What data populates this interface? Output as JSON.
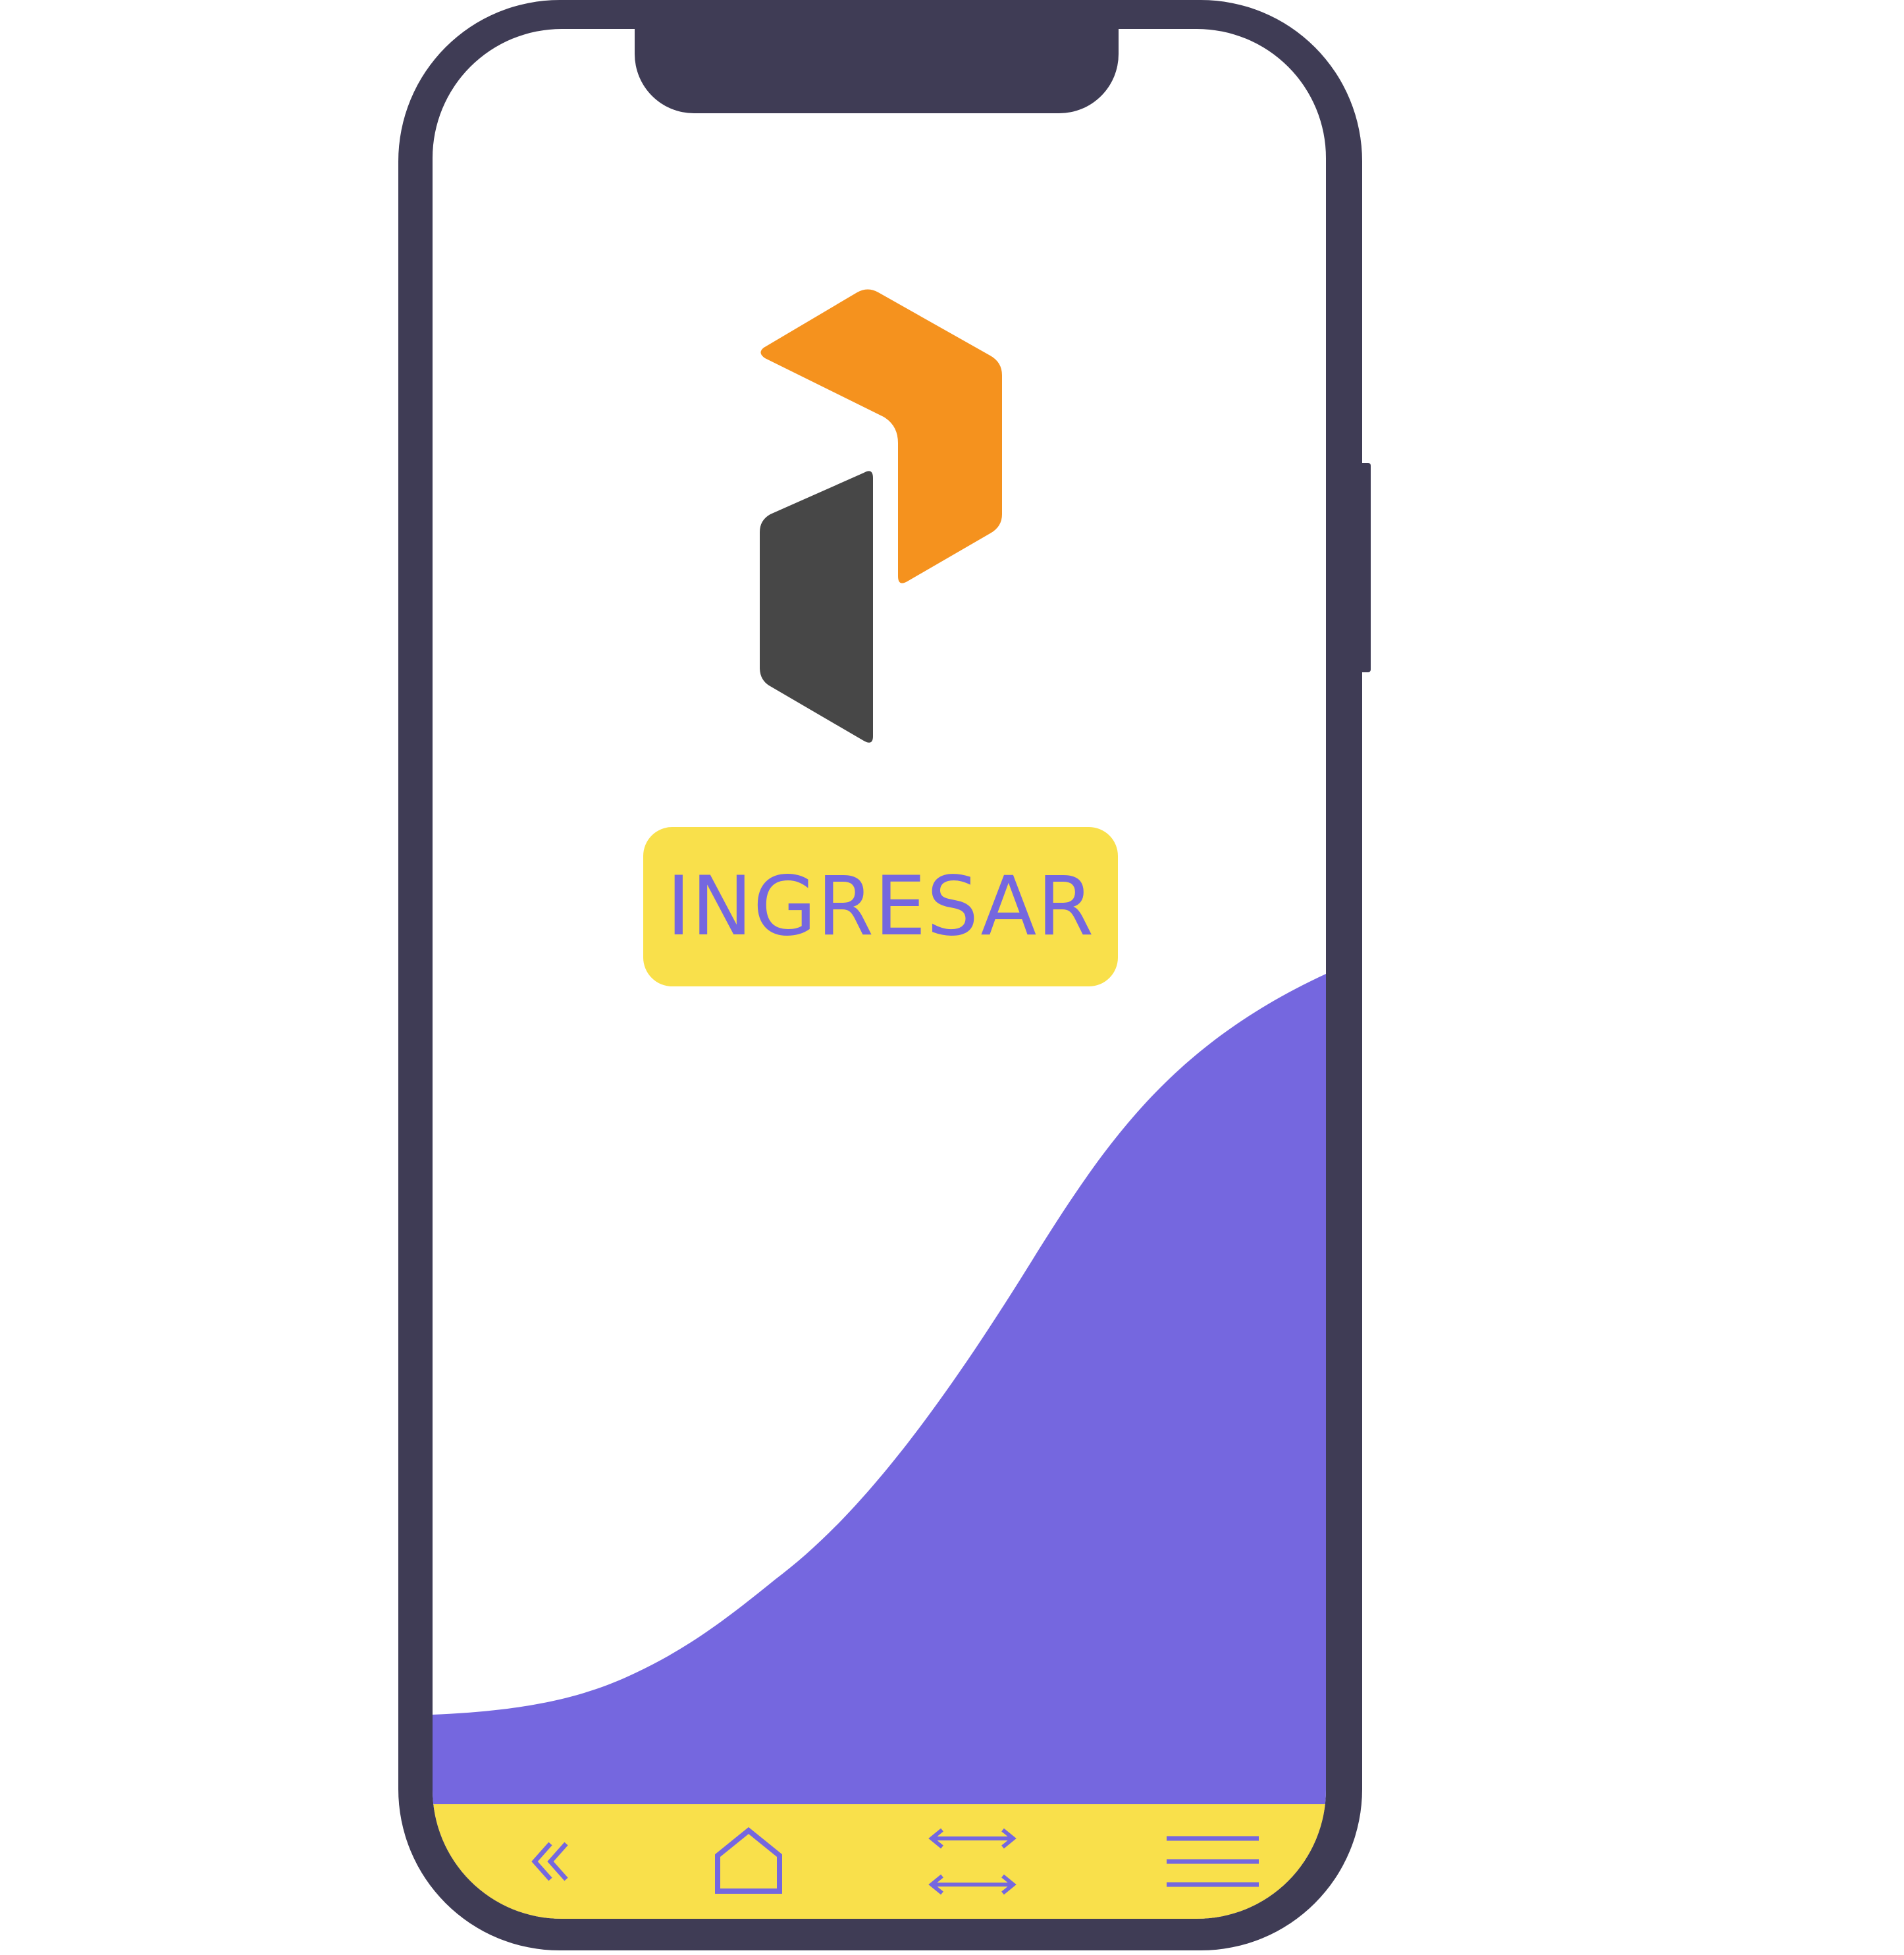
{
  "app": {
    "enter_button_label": "INGRESAR"
  },
  "logo": {
    "icon": "brand-logo-icon",
    "colors": {
      "orange": "#f5921e",
      "dark": "#474747"
    }
  },
  "bottom_nav": {
    "items": [
      {
        "icon": "double-chevron-left-icon"
      },
      {
        "icon": "home-icon"
      },
      {
        "icon": "swap-arrows-icon"
      },
      {
        "icon": "menu-icon"
      }
    ]
  },
  "colors": {
    "frame": "#3f3c55",
    "accent_purple": "#7567df",
    "accent_yellow": "#f9e04b",
    "screen_bg": "#ffffff"
  }
}
